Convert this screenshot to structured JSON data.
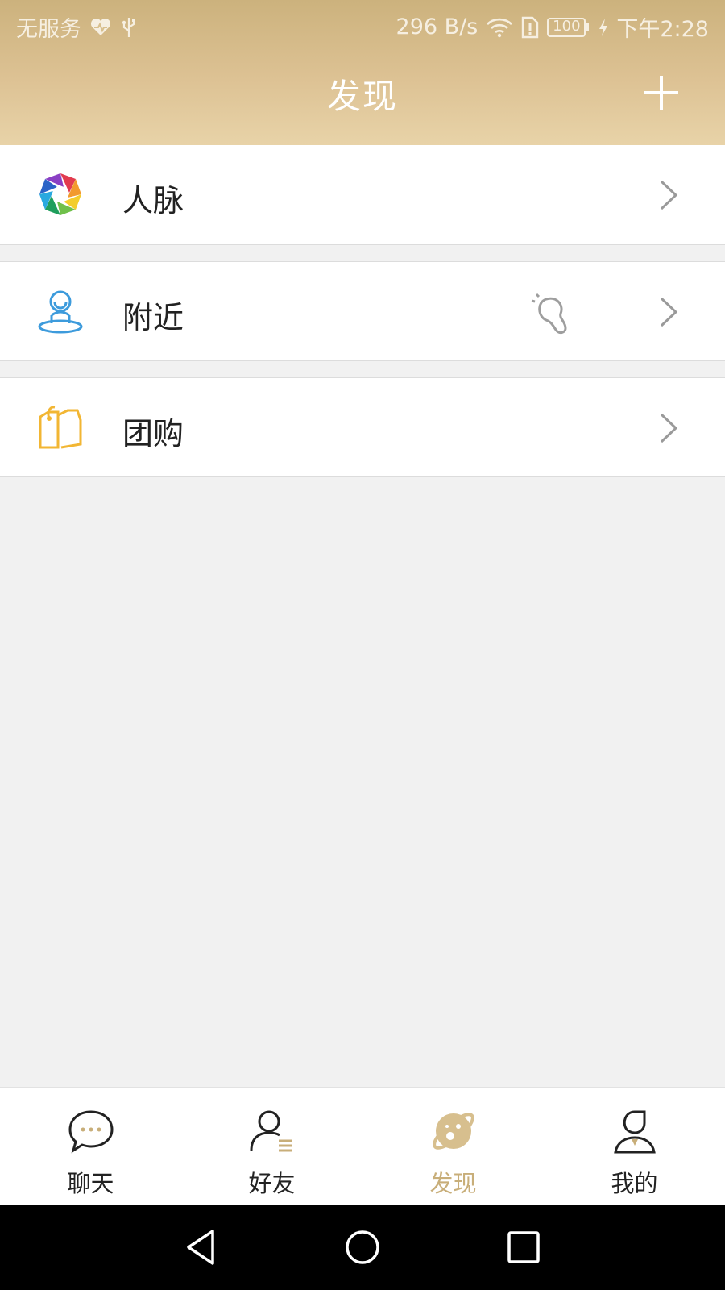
{
  "status_bar": {
    "carrier": "无服务",
    "speed": "296 B/s",
    "battery": "100",
    "time": "下午2:28"
  },
  "header": {
    "title": "发现"
  },
  "items": [
    {
      "label": "人脉",
      "icon": "aperture-icon"
    },
    {
      "label": "附近",
      "icon": "person-location-icon",
      "extra_icon": "footprint-icon"
    },
    {
      "label": "团购",
      "icon": "price-tag-icon"
    }
  ],
  "tabs": [
    {
      "label": "聊天",
      "icon": "chat-bubble-icon",
      "active": false
    },
    {
      "label": "好友",
      "icon": "friends-icon",
      "active": false
    },
    {
      "label": "发现",
      "icon": "planet-icon",
      "active": true
    },
    {
      "label": "我的",
      "icon": "profile-icon",
      "active": false
    }
  ],
  "colors": {
    "header_gradient_top": "#ccb27d",
    "header_gradient_bottom": "#e8d3a8",
    "active_tab": "#c8ae79",
    "background": "#f1f1f1"
  }
}
